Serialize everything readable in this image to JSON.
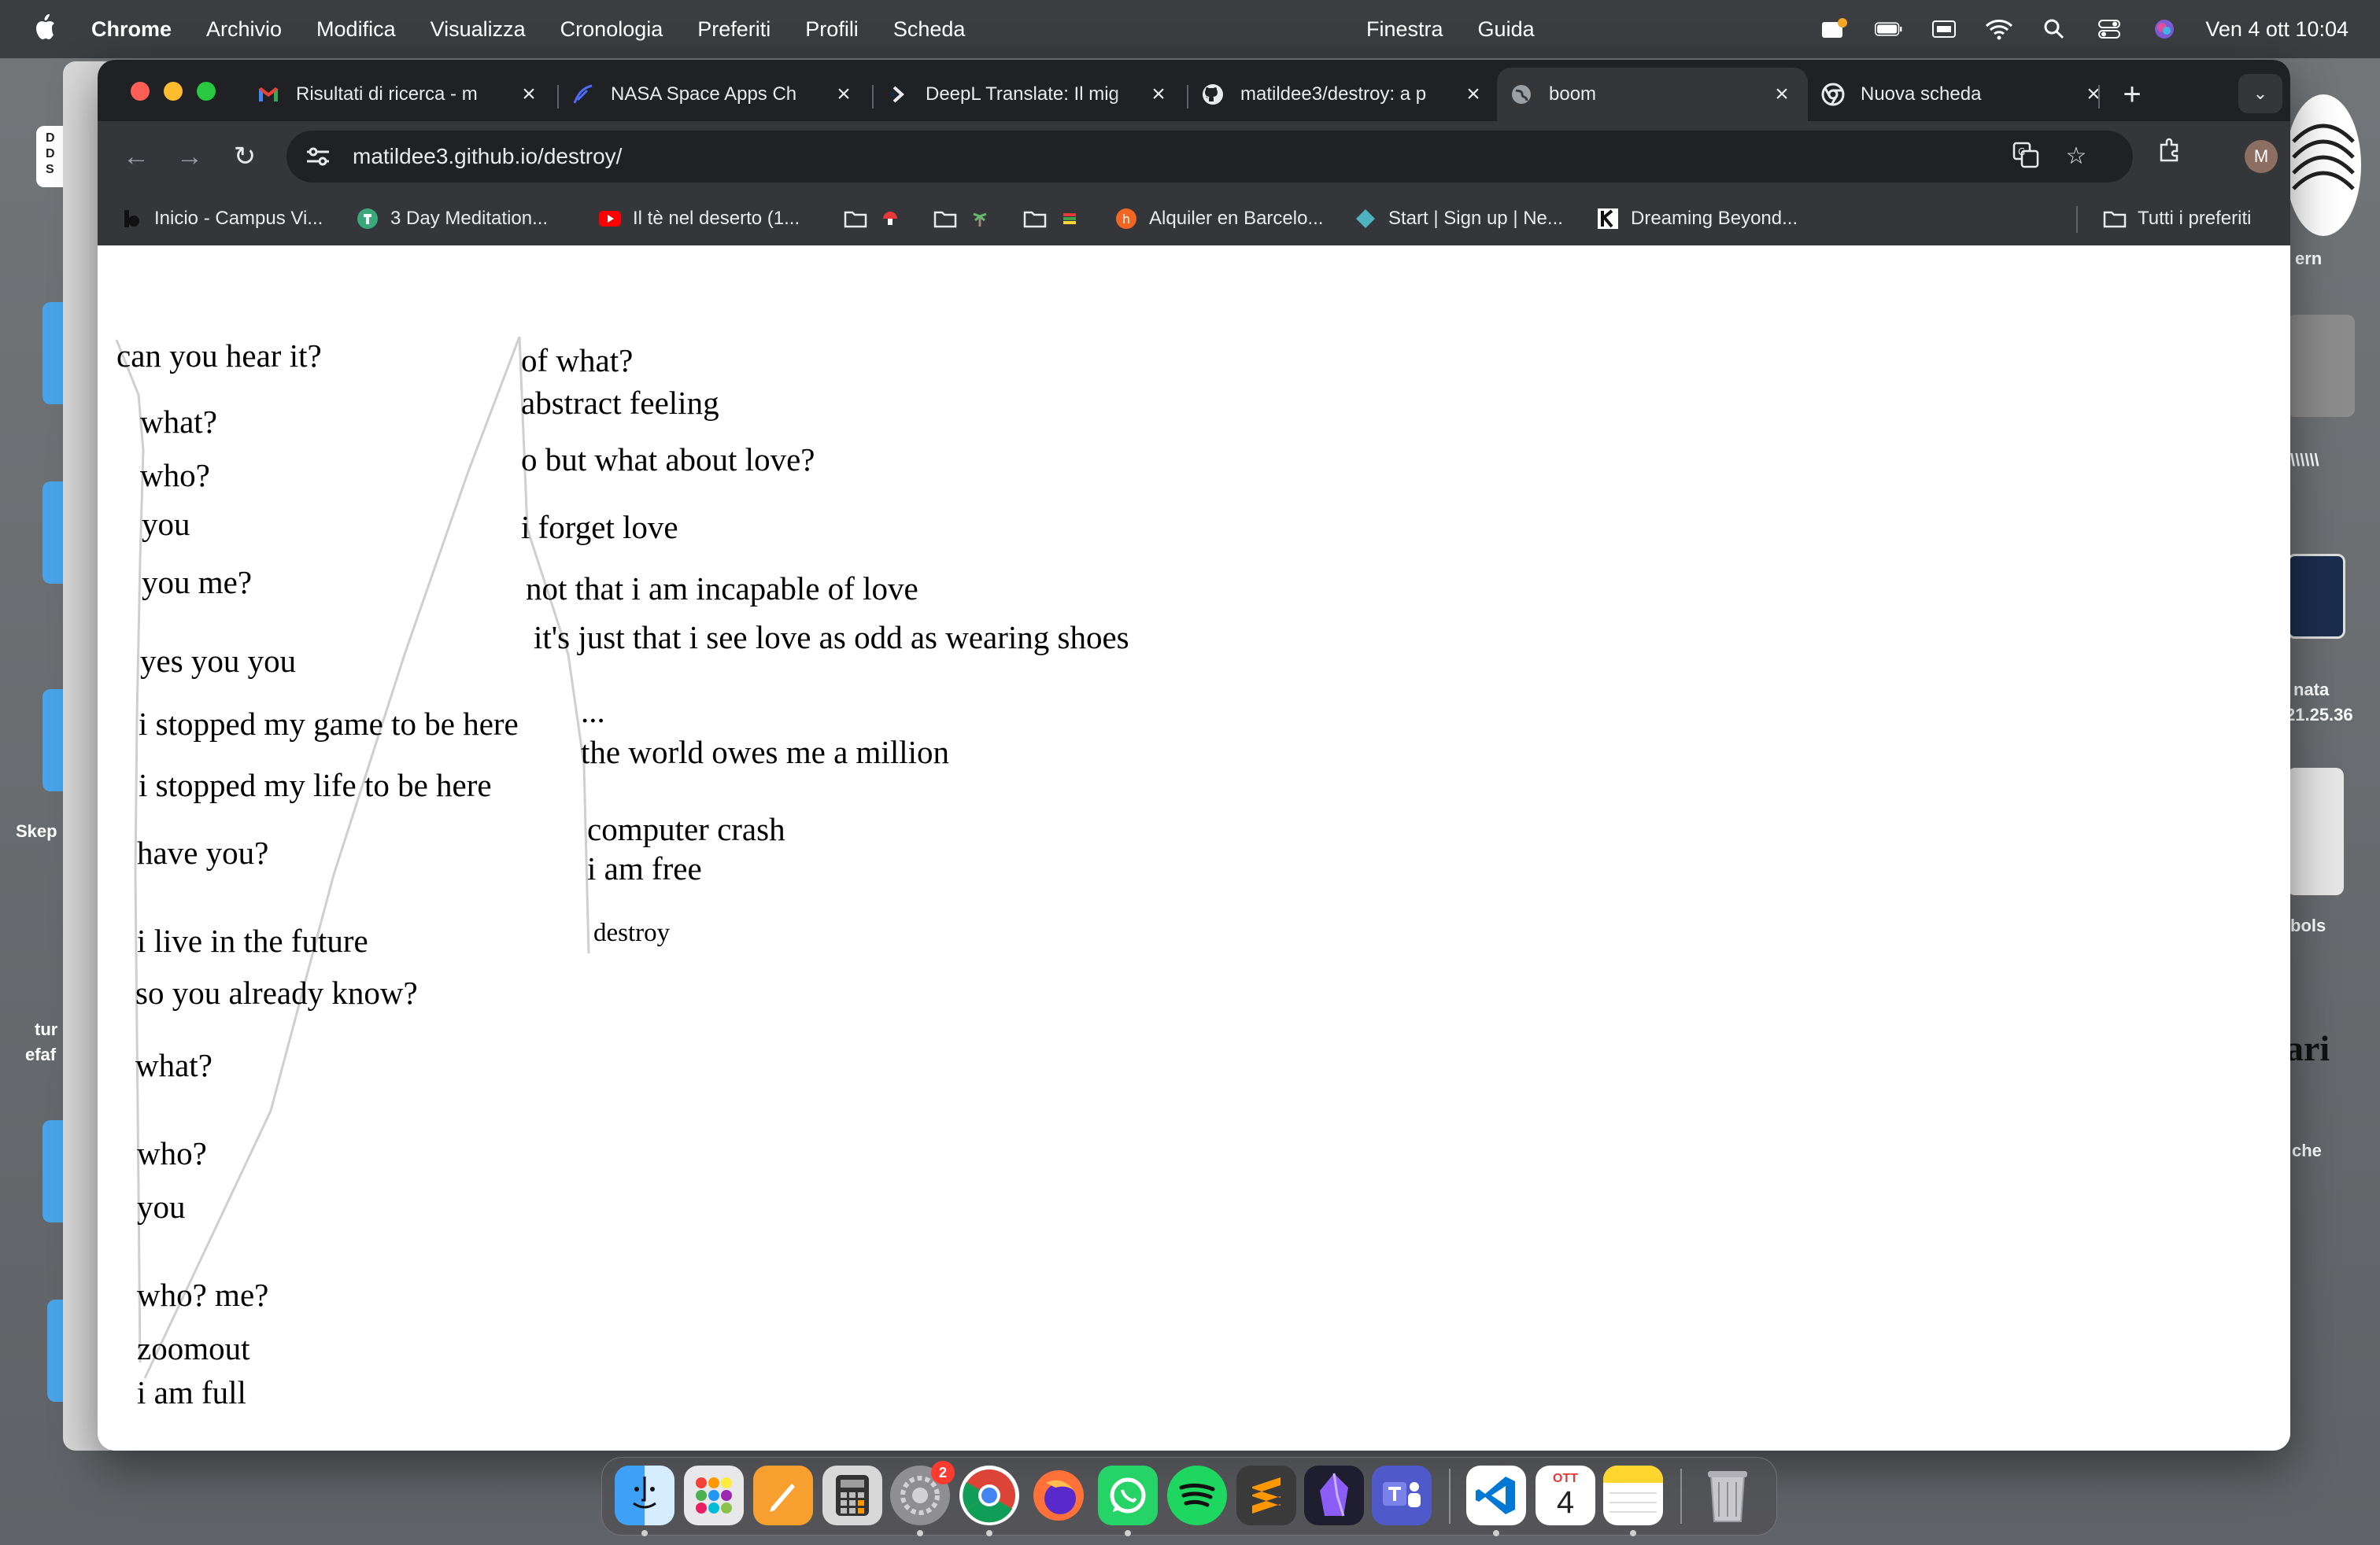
{
  "menubar": {
    "app_name": "Chrome",
    "items": [
      "Archivio",
      "Modifica",
      "Visualizza",
      "Cronologia",
      "Preferiti",
      "Profili",
      "Scheda"
    ],
    "center_items": [
      "Finestra",
      "Guida"
    ],
    "clock": "Ven 4 ott  10:04"
  },
  "desktop": {
    "labels": [
      "Skep",
      "tur",
      "efaf",
      "ern",
      "\\\\\\\\\\\\",
      "nata",
      "21.25.36",
      "bols",
      "ari",
      "che"
    ],
    "side_label_dds": [
      "D",
      "D",
      "S"
    ]
  },
  "tabs": [
    {
      "title": "Risultati di ricerca - m",
      "icon": "gmail-icon"
    },
    {
      "title": "NASA Space Apps Ch",
      "icon": "nasa-icon"
    },
    {
      "title": "DeepL Translate: Il mig",
      "icon": "deepl-icon"
    },
    {
      "title": "matildee3/destroy: a p",
      "icon": "github-icon"
    },
    {
      "title": "boom",
      "icon": "globe-icon",
      "active": true
    },
    {
      "title": "Nuova scheda",
      "icon": "chrome-icon"
    }
  ],
  "omnibox": {
    "url": "matildee3.github.io/destroy/"
  },
  "profile": {
    "initial": "M"
  },
  "bookmarks": [
    {
      "label": "Inicio - Campus Vi...",
      "icon": "campus-icon"
    },
    {
      "label": "3 Day Meditation...",
      "icon": "meditation-icon"
    },
    {
      "label": "Il tè nel deserto (1...",
      "icon": "youtube-icon"
    },
    {
      "label": "",
      "icon": "folder-icon"
    },
    {
      "label": "",
      "icon": "folder-icon"
    },
    {
      "label": "",
      "icon": "folder-icon"
    },
    {
      "label": "Alquiler en Barcelo...",
      "icon": "habitaclia-icon"
    },
    {
      "label": "Start | Sign up | Ne...",
      "icon": "diamond-icon"
    },
    {
      "label": "Dreaming Beyond...",
      "icon": "k-icon"
    },
    {
      "label": "Tutti i preferiti",
      "icon": "folder-icon"
    }
  ],
  "poem": {
    "left_column": [
      "can you hear it?",
      "what?",
      "who?",
      "you",
      "you me?",
      "yes you you",
      "i stopped my game to be here",
      "i stopped my life to be here",
      "have you?",
      "i live in the future",
      "so you already know?",
      "what?",
      "who?",
      "you",
      "who? me?",
      "zoomout",
      "i am full"
    ],
    "right_column": [
      "of what?",
      "abstract feeling",
      "o but what about love?",
      "i forget love",
      "not that i am incapable of love",
      "it's just that i see love as odd as wearing shoes",
      "...",
      "the world owes me a million",
      "computer crash",
      "i am free",
      "destroy"
    ]
  },
  "dock": {
    "apps": [
      "finder-icon",
      "launchpad-icon",
      "pages-icon",
      "calculator-icon",
      "system-settings-icon",
      "chrome-icon",
      "firefox-icon",
      "whatsapp-icon",
      "spotify-icon",
      "sublime-icon",
      "obsidian-icon",
      "teams-icon",
      "vscode-icon",
      "calendar-icon",
      "notes-icon",
      "trash-icon"
    ],
    "settings_badge": "2",
    "calendar_month": "OTT",
    "calendar_day": "4"
  }
}
